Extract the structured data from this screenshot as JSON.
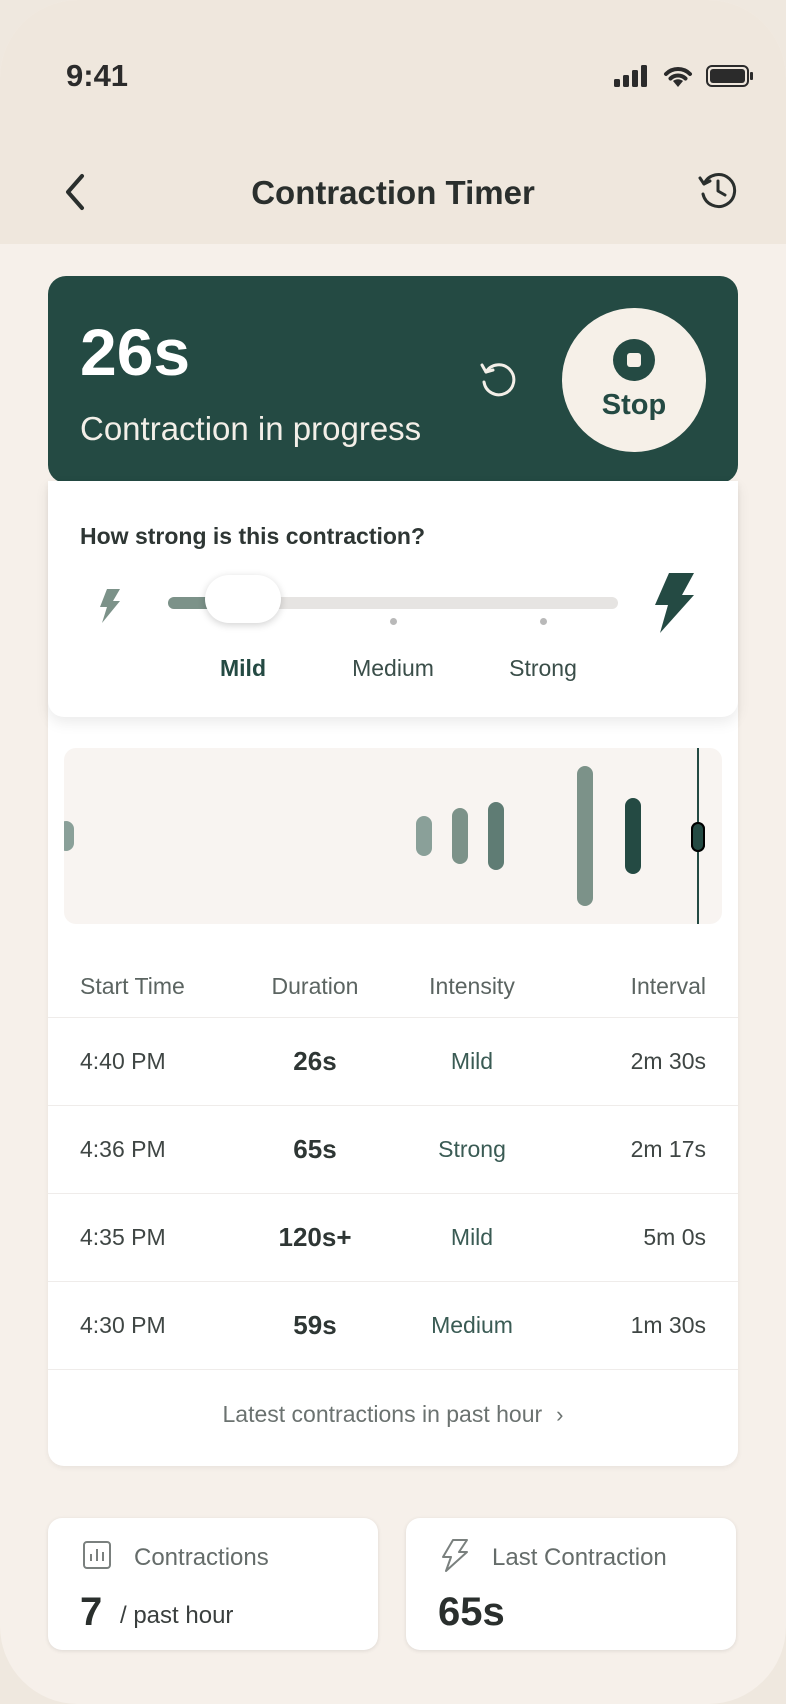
{
  "status_bar": {
    "time": "9:41"
  },
  "nav": {
    "title": "Contraction Timer"
  },
  "timer": {
    "elapsed": "26s",
    "status": "Contraction in progress",
    "stop_label": "Stop"
  },
  "intensity": {
    "question": "How strong is this contraction?",
    "levels": [
      "Mild",
      "Medium",
      "Strong"
    ],
    "selected": "Mild"
  },
  "timeline": {
    "bars": [
      {
        "level": 1
      },
      {
        "level": 1
      },
      {
        "level": 1
      },
      {
        "level": 2
      },
      {
        "level": 3
      },
      {
        "level": 3
      }
    ]
  },
  "table": {
    "headers": {
      "start": "Start Time",
      "duration": "Duration",
      "intensity": "Intensity",
      "interval": "Interval"
    },
    "rows": [
      {
        "start": "4:40 PM",
        "duration": "26s",
        "intensity": "Mild",
        "interval": "2m 30s"
      },
      {
        "start": "4:36 PM",
        "duration": "65s",
        "intensity": "Strong",
        "interval": "2m 17s"
      },
      {
        "start": "4:35 PM",
        "duration": "120s+",
        "intensity": "Mild",
        "interval": "5m 0s"
      },
      {
        "start": "4:30 PM",
        "duration": "59s",
        "intensity": "Medium",
        "interval": "1m 30s"
      }
    ],
    "footer_link": "Latest contractions in past hour"
  },
  "stats": {
    "contractions": {
      "label": "Contractions",
      "value": "7",
      "unit": "/ past hour"
    },
    "last": {
      "label": "Last Contraction",
      "value": "65s"
    }
  },
  "colors": {
    "primary": "#244a43",
    "background": "#f6f0ea",
    "topbar": "#efe7dd"
  }
}
